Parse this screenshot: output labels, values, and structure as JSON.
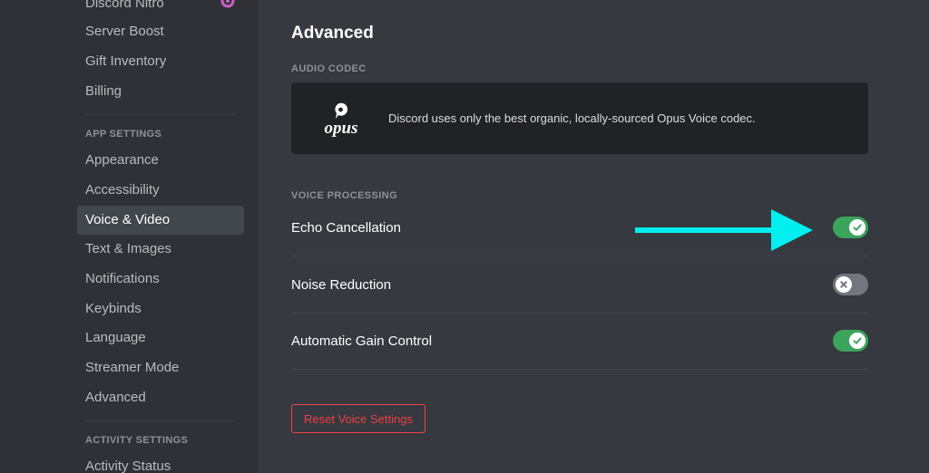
{
  "sidebar": {
    "nitro_label": "Discord Nitro",
    "items_top": [
      "Server Boost",
      "Gift Inventory",
      "Billing"
    ],
    "app_settings_header": "APP SETTINGS",
    "app_items": [
      "Appearance",
      "Accessibility",
      "Voice & Video",
      "Text & Images",
      "Notifications",
      "Keybinds",
      "Language",
      "Streamer Mode",
      "Advanced"
    ],
    "active_item": "Voice & Video",
    "activity_settings_header": "ACTIVITY SETTINGS",
    "activity_items": [
      "Activity Status"
    ]
  },
  "main": {
    "title": "Advanced",
    "audio_codec": {
      "label": "AUDIO CODEC",
      "logo_text": "opus",
      "description": "Discord uses only the best organic, locally-sourced Opus Voice codec."
    },
    "voice_processing": {
      "label": "VOICE PROCESSING",
      "settings": [
        {
          "label": "Echo Cancellation",
          "enabled": true
        },
        {
          "label": "Noise Reduction",
          "enabled": false
        },
        {
          "label": "Automatic Gain Control",
          "enabled": true
        }
      ]
    },
    "reset_button": "Reset Voice Settings"
  },
  "annotation": {
    "arrow_color": "#00f0f0",
    "arrow_target": "Echo Cancellation toggle"
  },
  "colors": {
    "toggle_on": "#3ba55c",
    "toggle_off": "#72767d",
    "danger": "#ed4245",
    "nitro": "#c760c4"
  }
}
